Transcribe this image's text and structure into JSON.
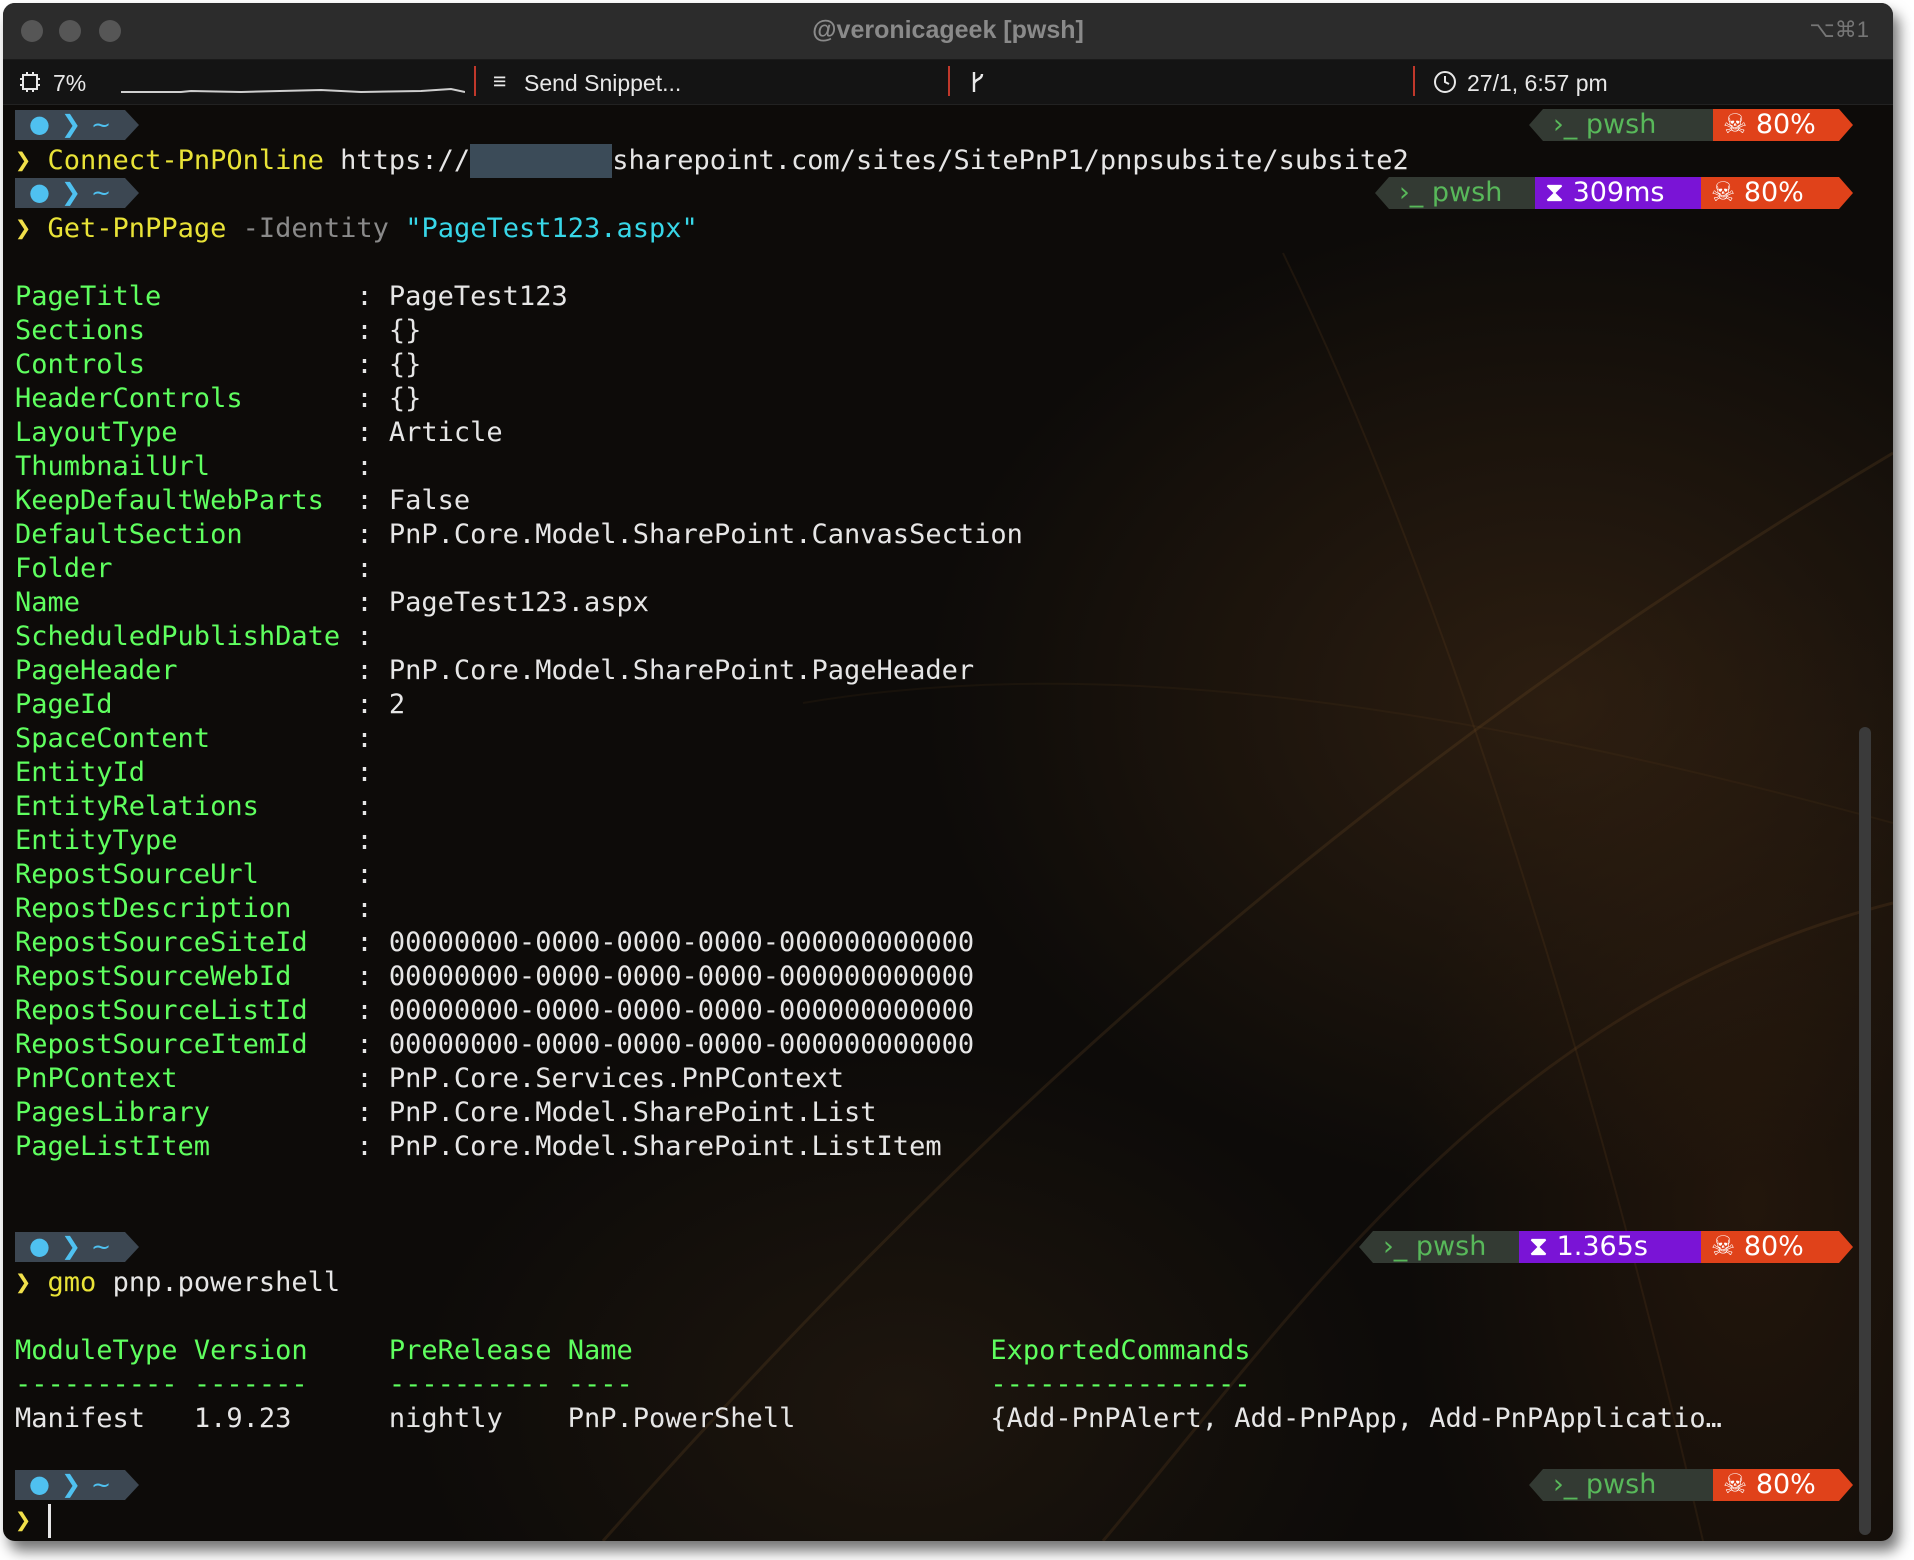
{
  "window": {
    "title": "@veronicageek [pwsh]",
    "shortcut": "⌥⌘1"
  },
  "statusbar": {
    "cpu": "7%",
    "snippet": "Send Snippet...",
    "datetime": "27/1, 6:57 pm"
  },
  "prompt": {
    "dir": "~",
    "shell": "pwsh",
    "battery": "80%"
  },
  "commands": {
    "cmd1": {
      "name": "Connect-PnPOnline",
      "arg_start": "https://",
      "arg_end": "sharepoint.com/sites/SitePnP1/pnpsubsite/subsite2"
    },
    "cmd2": {
      "name": "Get-PnPPage",
      "param": "-Identity",
      "value": "\"PageTest123.aspx\"",
      "duration": "309ms"
    },
    "cmd3": {
      "name": "gmo",
      "arg": "pnp.powershell",
      "duration": "1.365s"
    }
  },
  "page_properties": [
    {
      "key": "PageTitle",
      "value": "PageTest123"
    },
    {
      "key": "Sections",
      "value": "{}"
    },
    {
      "key": "Controls",
      "value": "{}"
    },
    {
      "key": "HeaderControls",
      "value": "{}"
    },
    {
      "key": "LayoutType",
      "value": "Article"
    },
    {
      "key": "ThumbnailUrl",
      "value": ""
    },
    {
      "key": "KeepDefaultWebParts",
      "value": "False"
    },
    {
      "key": "DefaultSection",
      "value": "PnP.Core.Model.SharePoint.CanvasSection"
    },
    {
      "key": "Folder",
      "value": ""
    },
    {
      "key": "Name",
      "value": "PageTest123.aspx"
    },
    {
      "key": "ScheduledPublishDate",
      "value": ""
    },
    {
      "key": "PageHeader",
      "value": "PnP.Core.Model.SharePoint.PageHeader"
    },
    {
      "key": "PageId",
      "value": "2"
    },
    {
      "key": "SpaceContent",
      "value": ""
    },
    {
      "key": "EntityId",
      "value": ""
    },
    {
      "key": "EntityRelations",
      "value": ""
    },
    {
      "key": "EntityType",
      "value": ""
    },
    {
      "key": "RepostSourceUrl",
      "value": ""
    },
    {
      "key": "RepostDescription",
      "value": ""
    },
    {
      "key": "RepostSourceSiteId",
      "value": "00000000-0000-0000-0000-000000000000"
    },
    {
      "key": "RepostSourceWebId",
      "value": "00000000-0000-0000-0000-000000000000"
    },
    {
      "key": "RepostSourceListId",
      "value": "00000000-0000-0000-0000-000000000000"
    },
    {
      "key": "RepostSourceItemId",
      "value": "00000000-0000-0000-0000-000000000000"
    },
    {
      "key": "PnPContext",
      "value": "PnP.Core.Services.PnPContext"
    },
    {
      "key": "PagesLibrary",
      "value": "PnP.Core.Model.SharePoint.List"
    },
    {
      "key": "PageListItem",
      "value": "PnP.Core.Model.SharePoint.ListItem"
    }
  ],
  "module_table": {
    "headers": {
      "moduletype": "ModuleType",
      "version": "Version",
      "prerelease": "PreRelease",
      "name": "Name",
      "exported": "ExportedCommands"
    },
    "dashes": {
      "moduletype": "----------",
      "version": "-------",
      "prerelease": "----------",
      "name": "----",
      "exported": "----------------"
    },
    "row": {
      "moduletype": "Manifest",
      "version": "1.9.23",
      "prerelease": "nightly",
      "name": "PnP.PowerShell",
      "exported": "{Add-PnPAlert, Add-PnPApp, Add-PnPApplicatio…"
    }
  },
  "colors": {
    "key_green": "#5fff5f",
    "command_yellow": "#e9e337",
    "string_cyan": "#38d7e8",
    "battery_orange": "#e0421a",
    "timer_purple": "#7a14d6"
  }
}
